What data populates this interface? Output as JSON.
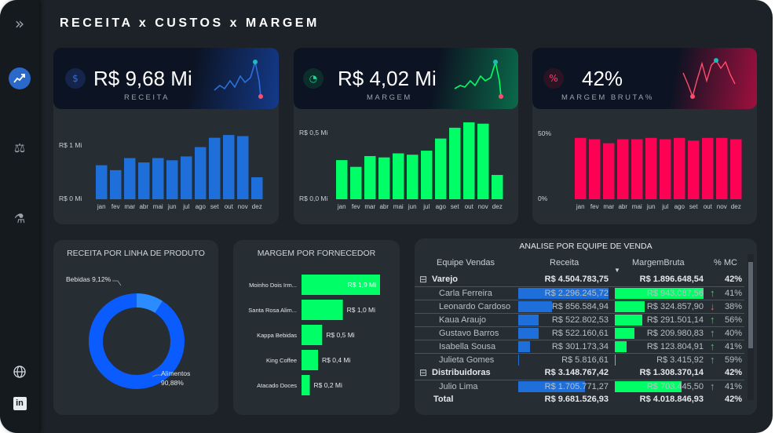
{
  "title": "RECEITA x CUSTOS x MARGEM",
  "sidebar": {
    "items": [
      {
        "icon": "expand-icon",
        "glyph": "»"
      },
      {
        "icon": "chart-icon",
        "glyph": "📈"
      },
      {
        "icon": "scale-icon",
        "glyph": "⚖"
      },
      {
        "icon": "flask-icon",
        "glyph": "⚗"
      },
      {
        "icon": "globe-icon",
        "glyph": "🌐"
      },
      {
        "icon": "linkedin-icon",
        "glyph": "in"
      }
    ]
  },
  "kpis": [
    {
      "value": "R$ 9,68 Mi",
      "label": "RECEITA",
      "icon_glyph": "$",
      "color": "#1e6fd9"
    },
    {
      "value": "R$ 4,02 Mi",
      "label": "MARGEM",
      "icon_glyph": "◔",
      "color": "#00ff66"
    },
    {
      "value": "42%",
      "label": "MARGEM BRUTA%",
      "icon_glyph": "%",
      "color": "#ff1a5c"
    }
  ],
  "chart_data": [
    {
      "type": "bar",
      "categories": [
        "jan",
        "fev",
        "mar",
        "abr",
        "mai",
        "jun",
        "jul",
        "ago",
        "set",
        "out",
        "nov",
        "dez"
      ],
      "values": [
        0.62,
        0.53,
        0.75,
        0.67,
        0.75,
        0.71,
        0.78,
        0.95,
        1.12,
        1.17,
        1.15,
        0.4
      ],
      "tick_labels": [
        "R$ 1 Mi",
        "R$ 0 Mi"
      ],
      "ylim": [
        0,
        1.0
      ],
      "color": "#1e6fd9"
    },
    {
      "type": "bar",
      "categories": [
        "jan",
        "fev",
        "mar",
        "abr",
        "mai",
        "jun",
        "jul",
        "ago",
        "set",
        "out",
        "nov",
        "dez"
      ],
      "values": [
        0.29,
        0.24,
        0.32,
        0.31,
        0.34,
        0.33,
        0.36,
        0.45,
        0.53,
        0.57,
        0.56,
        0.18
      ],
      "tick_labels": [
        "R$ 0,5 Mi",
        "R$ 0,0 Mi"
      ],
      "ylim": [
        0,
        0.5
      ],
      "color": "#00ff66"
    },
    {
      "type": "bar",
      "categories": [
        "jan",
        "fev",
        "mar",
        "abr",
        "mai",
        "jun",
        "jul",
        "ago",
        "set",
        "out",
        "nov",
        "dez"
      ],
      "values": [
        0.46,
        0.45,
        0.42,
        0.45,
        0.45,
        0.46,
        0.45,
        0.46,
        0.44,
        0.46,
        0.46,
        0.45
      ],
      "tick_labels": [
        "50%",
        "0%"
      ],
      "ylim": [
        0,
        0.5
      ],
      "color": "#ff0055"
    },
    {
      "type": "pie",
      "title": "RECEITA POR LINHA DE PRODUTO",
      "slices": [
        {
          "label": "Alimentos",
          "pct_label": "90,88%",
          "value": 90.88,
          "color": "#0a5cff"
        },
        {
          "label": "Bebidas",
          "pct_label": "9,12%",
          "value": 9.12,
          "color": "#2b8cff"
        }
      ]
    },
    {
      "type": "bar",
      "title": "MARGEM POR FORNECEDOR",
      "categories": [
        "Moinho Dois Irm...",
        "Santa Rosa Alim...",
        "Kappa Bebidas",
        "King Coffee",
        "Atacado Doces"
      ],
      "values": [
        1.9,
        1.0,
        0.5,
        0.4,
        0.2
      ],
      "value_labels": [
        "R$ 1,9 Mi",
        "R$ 1,0 Mi",
        "R$ 0,5 Mi",
        "R$ 0,4 Mi",
        "R$ 0,2 Mi"
      ],
      "color": "#00ff66"
    },
    {
      "type": "table",
      "title": "ANALISE POR EQUIPE DE VENDA",
      "headers": [
        "Equipe Vendas",
        "Receita",
        "MargemBruta",
        "% MC"
      ],
      "rows": [
        {
          "kind": "group",
          "name": "Varejo",
          "receita": "R$ 4.504.783,75",
          "margem": "R$ 1.896.648,54",
          "mc": "42%"
        },
        {
          "kind": "item",
          "name": "Carla Ferreira",
          "receita": "R$ 2.296.245,72",
          "margem": "R$ 943.087,56",
          "mc": "41%",
          "rec_frac": 1.0,
          "mar_frac": 1.0,
          "trend": "up"
        },
        {
          "kind": "item",
          "name": "Leonardo Cardoso",
          "receita": "R$ 856.584,94",
          "margem": "R$ 324.857,90",
          "mc": "38%",
          "rec_frac": 0.37,
          "mar_frac": 0.34,
          "trend": "down"
        },
        {
          "kind": "item",
          "name": "Kaua Araujo",
          "receita": "R$ 522.802,53",
          "margem": "R$ 291.501,14",
          "mc": "56%",
          "rec_frac": 0.23,
          "mar_frac": 0.31,
          "trend": "up"
        },
        {
          "kind": "item",
          "name": "Gustavo Barros",
          "receita": "R$ 522.160,61",
          "margem": "R$ 209.980,83",
          "mc": "40%",
          "rec_frac": 0.23,
          "mar_frac": 0.22,
          "trend": "up"
        },
        {
          "kind": "item",
          "name": "Isabella Sousa",
          "receita": "R$ 301.173,34",
          "margem": "R$ 123.804,91",
          "mc": "41%",
          "rec_frac": 0.13,
          "mar_frac": 0.13,
          "trend": "up"
        },
        {
          "kind": "item",
          "name": "Julieta Gomes",
          "receita": "R$ 5.816,61",
          "margem": "R$ 3.415,92",
          "mc": "59%",
          "rec_frac": 0.003,
          "mar_frac": 0.004,
          "trend": "up"
        },
        {
          "kind": "group",
          "name": "Distribuidoras",
          "receita": "R$ 3.148.767,42",
          "margem": "R$ 1.308.370,14",
          "mc": "42%"
        },
        {
          "kind": "item",
          "name": "Julio Lima",
          "receita": "R$ 1.705.771,27",
          "margem": "R$ 703.445,50",
          "mc": "41%",
          "rec_frac": 0.74,
          "mar_frac": 0.75,
          "trend": "up"
        },
        {
          "kind": "total",
          "name": "Total",
          "receita": "R$ 9.681.526,93",
          "margem": "R$ 4.018.846,93",
          "mc": "42%"
        }
      ]
    }
  ]
}
